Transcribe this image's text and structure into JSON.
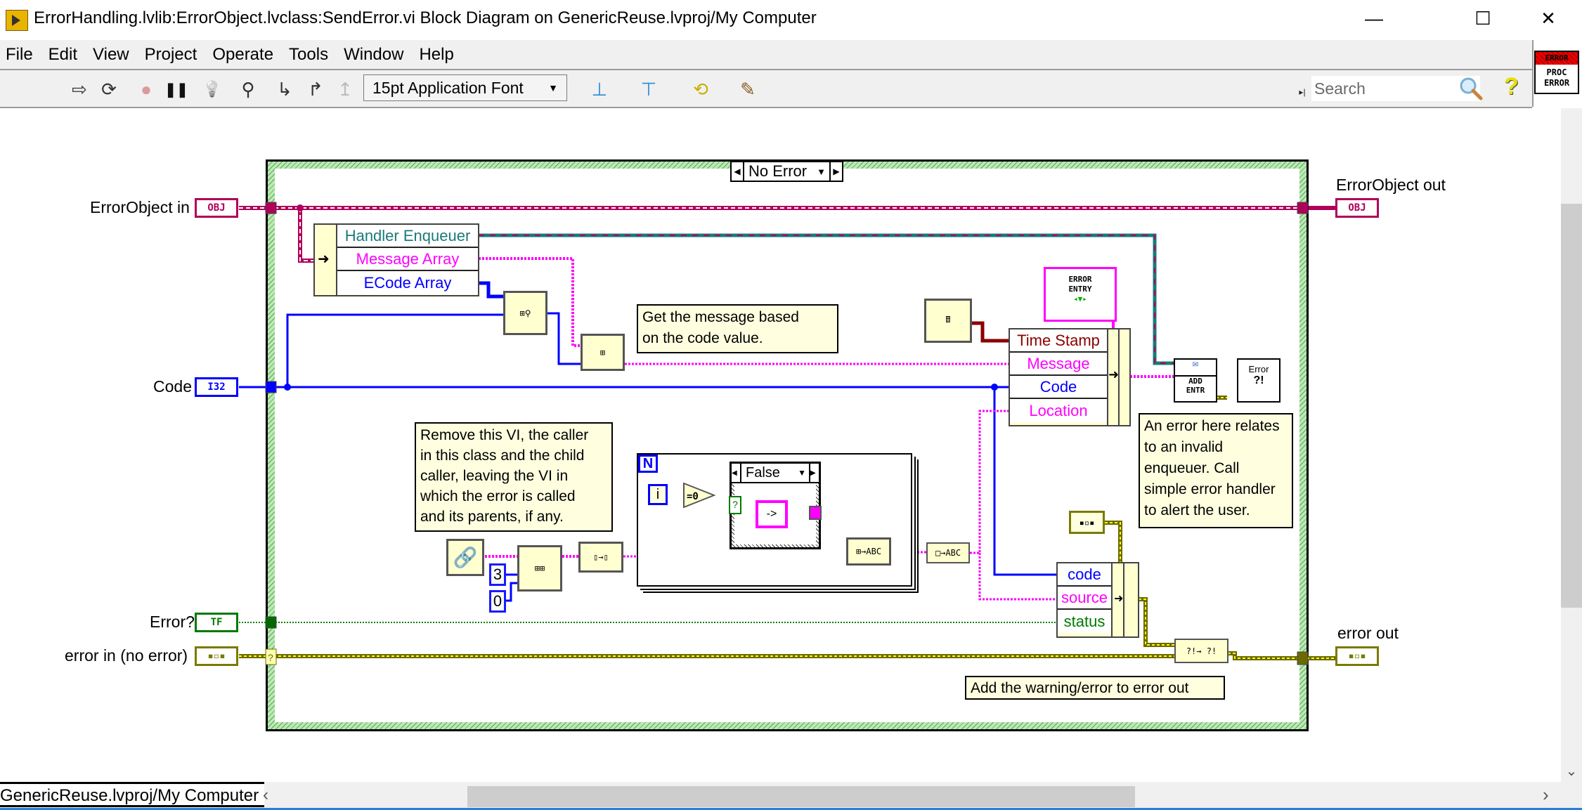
{
  "window": {
    "title": "ErrorHandling.lvlib:ErrorObject.lvclass:SendError.vi Block Diagram on GenericReuse.lvproj/My Computer",
    "minimize_glyph": "—",
    "maximize_glyph": "☐",
    "close_glyph": "✕"
  },
  "menu": [
    "File",
    "Edit",
    "View",
    "Project",
    "Operate",
    "Tools",
    "Window",
    "Help"
  ],
  "toolbar": {
    "buttons": [
      {
        "name": "run-arrow-icon",
        "glyph": "⇨"
      },
      {
        "name": "run-continuously-icon",
        "glyph": "⟳"
      },
      {
        "name": "abort-execution-icon",
        "glyph": "●"
      },
      {
        "name": "pause-icon",
        "glyph": "❚❚"
      },
      {
        "name": "highlight-execution-icon",
        "glyph": "💡"
      },
      {
        "name": "retain-wire-values-icon",
        "glyph": "⚲"
      },
      {
        "name": "step-into-icon",
        "glyph": "↳"
      },
      {
        "name": "step-over-icon",
        "glyph": "↱"
      },
      {
        "name": "step-out-icon",
        "glyph": "↥"
      }
    ],
    "font_select": "15pt Application Font",
    "align_glyph": "⊥",
    "distribute_glyph": "⊤",
    "reorder_glyph": "⟲",
    "cleanup_glyph": "✎",
    "search_placeholder": "Search",
    "help_glyph": "?",
    "vi_icon": {
      "top": "ERROR",
      "line1": "PROC",
      "line2": "ERROR"
    }
  },
  "diagram": {
    "case_selector": "No Error",
    "terminals": {
      "error_object_in": {
        "label": "ErrorObject in",
        "type": "OBJ"
      },
      "code": {
        "label": "Code",
        "type": "I32"
      },
      "error_flag": {
        "label": "Error?",
        "type": "TF"
      },
      "error_in": {
        "label": "error in (no error)",
        "type": "▪▫▪"
      },
      "error_object_out": {
        "label": "ErrorObject out",
        "type": "OBJ"
      },
      "error_out": {
        "label": "error out",
        "type": "▪▫▪"
      }
    },
    "unbundle_class": [
      "Handler Enqueuer",
      "Message Array",
      "ECode Array"
    ],
    "bundle_entry": [
      "Time Stamp",
      "Message",
      "Code",
      "Location"
    ],
    "bundle_error": [
      "code",
      "source",
      "status"
    ],
    "comments": {
      "get_message": [
        "Get the message based",
        "on the code value."
      ],
      "remove_vi": [
        "Remove this VI, the caller",
        "in this class and the child",
        "caller, leaving the VI in",
        "which the error is called",
        "and its parents, if any."
      ],
      "invalid_enqueuer": [
        "An error here relates",
        "to an invalid",
        "enqueuer. Call",
        "simple error handler",
        "to alert the user."
      ],
      "add_warning": "Add the warning/error to error out"
    },
    "constants": {
      "three": "3",
      "zero": "0"
    },
    "for_loop": {
      "count_label": "N",
      "iteration_label": "i",
      "inner_case": "False",
      "equal_zero": "=0",
      "arrow_text": "->"
    },
    "nodes": {
      "error_entry_typedef": [
        "ERROR",
        "ENTRY"
      ],
      "add_entry": [
        "ADD",
        "ENTR"
      ],
      "simple_error": [
        "Error",
        "?!"
      ]
    }
  },
  "statusbar": {
    "project": "GenericReuse.lvproj/My Computer",
    "left_arrow": "‹",
    "right_arrow": "›",
    "down_arrow": "⌄"
  },
  "colors": {
    "class_wire": "#b0005a",
    "i32_wire": "#0000ff",
    "string_wire": "#ff00ff",
    "error_wire": "#7a7a00",
    "bool_wire": "#007a00",
    "frame_stripe": "#b6ecb0"
  }
}
